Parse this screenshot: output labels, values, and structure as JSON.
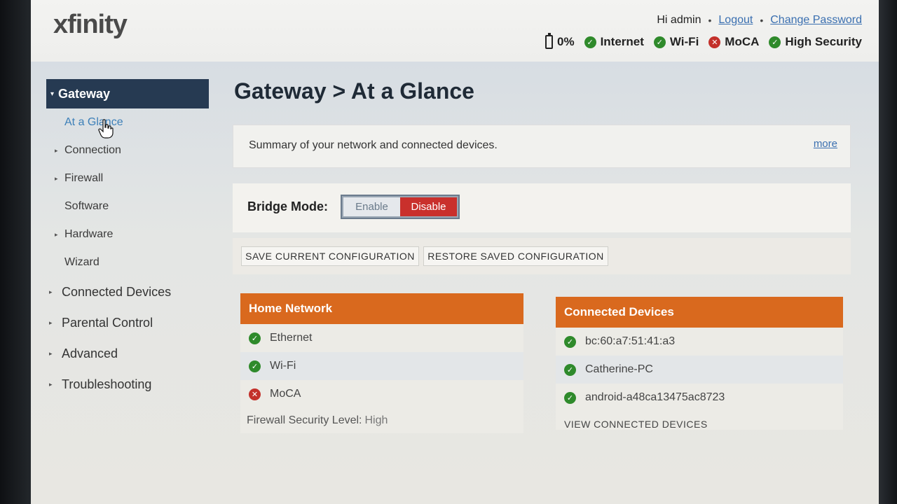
{
  "header": {
    "logo": "xfinity",
    "greeting": "Hi admin",
    "logout": "Logout",
    "change_password": "Change Password",
    "status": {
      "battery": "0%",
      "internet": "Internet",
      "wifi": "Wi-Fi",
      "moca": "MoCA",
      "security": "High Security"
    }
  },
  "sidebar": {
    "main": "Gateway",
    "sub": [
      "At a Glance",
      "Connection",
      "Firewall",
      "Software",
      "Hardware",
      "Wizard"
    ],
    "top": [
      "Connected Devices",
      "Parental Control",
      "Advanced",
      "Troubleshooting"
    ]
  },
  "main": {
    "title": "Gateway > At a Glance",
    "summary": "Summary of your network and connected devices.",
    "more": "more",
    "bridge_label": "Bridge Mode:",
    "bridge_enable": "Enable",
    "bridge_disable": "Disable",
    "save_config": "SAVE CURRENT CONFIGURATION",
    "restore_config": "RESTORE SAVED CONFIGURATION"
  },
  "home_network": {
    "title": "Home Network",
    "items": [
      {
        "label": "Ethernet",
        "status": "ok"
      },
      {
        "label": "Wi-Fi",
        "status": "ok"
      },
      {
        "label": "MoCA",
        "status": "error"
      }
    ],
    "firewall_label": "Firewall Security Level:",
    "firewall_value": "High"
  },
  "connected_devices": {
    "title": "Connected Devices",
    "items": [
      "bc:60:a7:51:41:a3",
      "Catherine-PC",
      "android-a48ca13475ac8723"
    ],
    "view_all": "VIEW CONNECTED DEVICES"
  },
  "colors": {
    "accent_orange": "#d9691e",
    "nav_dark": "#263a52",
    "disable_red": "#c9302c",
    "ok_green": "#2f8a2b"
  }
}
